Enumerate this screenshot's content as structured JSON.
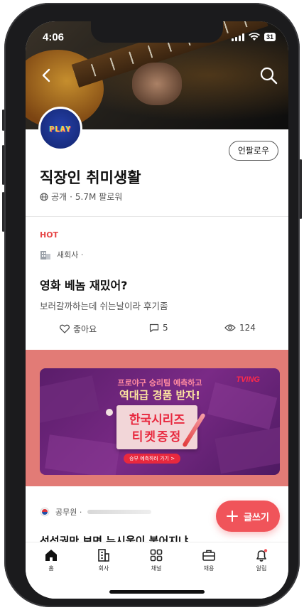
{
  "status_bar": {
    "time": "4:06",
    "battery": "31"
  },
  "channel": {
    "avatar_text": "PLAY",
    "unfollow_label": "언팔로우",
    "name": "직장인 취미생활",
    "visibility": "공개",
    "followers": "5.7M 팔로워"
  },
  "post1": {
    "badge": "HOT",
    "author": "새회사 ·",
    "title": "영화 베놈 재밌어?",
    "body": "보러갈까하는데 쉬는날이라 후기좀",
    "likes_label": "좋아요",
    "comments": "5",
    "views": "124"
  },
  "ad": {
    "line1": "프로야구 승리팀 예측하고",
    "line2": "역대급 경품 받자!",
    "brand": "TVING",
    "ticket_line1": "한국시리즈",
    "ticket_line2": "티켓증정",
    "cta": "승부 예측하러 가기 >",
    "background_color": "#e27b76"
  },
  "post2": {
    "author": "공무원 ·",
    "title": "선성권만 보면 누시울이 붉어지냐"
  },
  "write_button": {
    "label": "글쓰기",
    "color": "#f0545a"
  },
  "nav": {
    "items": [
      {
        "label": "홈",
        "icon": "home-icon"
      },
      {
        "label": "회사",
        "icon": "company-icon"
      },
      {
        "label": "채널",
        "icon": "channel-grid-icon"
      },
      {
        "label": "채용",
        "icon": "briefcase-icon"
      },
      {
        "label": "알림",
        "icon": "bell-icon"
      }
    ]
  }
}
